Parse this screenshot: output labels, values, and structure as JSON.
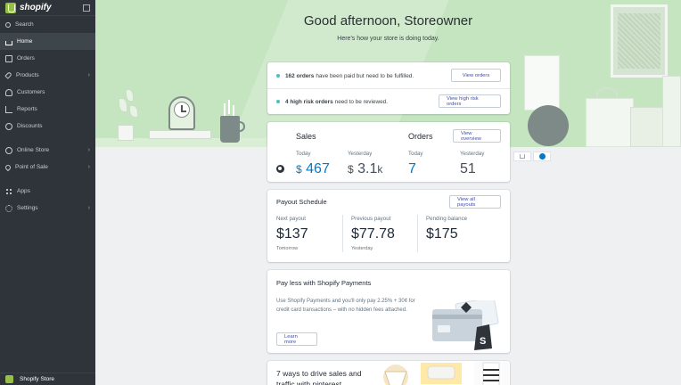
{
  "sidebar": {
    "brand": "shopify",
    "items": [
      {
        "label": "Search",
        "icon": "search-icon"
      },
      {
        "label": "Home",
        "icon": "home-icon"
      },
      {
        "label": "Orders",
        "icon": "orders-icon"
      },
      {
        "label": "Products",
        "icon": "products-icon"
      },
      {
        "label": "Customers",
        "icon": "customers-icon"
      },
      {
        "label": "Reports",
        "icon": "reports-icon"
      },
      {
        "label": "Discounts",
        "icon": "discounts-icon"
      },
      {
        "label": "Online Store",
        "icon": "online-store-icon"
      },
      {
        "label": "Point of Sale",
        "icon": "point-of-sale-icon"
      },
      {
        "label": "Apps",
        "icon": "apps-icon"
      },
      {
        "label": "Settings",
        "icon": "settings-icon"
      }
    ],
    "store_name": "Shopify Store"
  },
  "hero": {
    "greeting": "Good afternoon, Storeowner",
    "subtitle": "Here's how your store is doing today."
  },
  "tasks": {
    "paid_count": "162 orders",
    "paid_text": "have been paid but need to be fulfilled.",
    "paid_button": "View orders",
    "risk_count": "4 high risk orders",
    "risk_text": "need to be reviewed.",
    "risk_button": "View high risk orders"
  },
  "sales": {
    "sales_title": "Sales",
    "orders_title": "Orders",
    "overview_button": "View overview",
    "today_label": "Today",
    "yesterday_label": "Yesterday",
    "sales_currency": "$",
    "sales_today": "467",
    "sales_yesterday": "3.1",
    "sales_yesterday_suffix": "k",
    "orders_today": "7",
    "orders_yesterday": "51"
  },
  "payout": {
    "title": "Payout Schedule",
    "button": "View all payouts",
    "next_label": "Next payout",
    "next_value": "$137",
    "next_note": "Tomorrow",
    "prev_label": "Previous payout",
    "prev_value": "$77.78",
    "prev_note": "Yesterday",
    "pending_label": "Pending balance",
    "pending_value": "$175"
  },
  "payments": {
    "title": "Pay less with Shopify Payments",
    "body": "Use Shopify Payments and you'll only pay 2.25% + 30¢ for credit card transactions – with no hidden fees attached.",
    "button": "Learn more"
  },
  "pinterest": {
    "title": "7 ways to drive sales and traffic with pinterest"
  },
  "colors": {
    "sidebar": "#2e3439",
    "hero": "#c4e5bf",
    "accent_blue": "#007ace",
    "brand_green": "#95bf47"
  }
}
